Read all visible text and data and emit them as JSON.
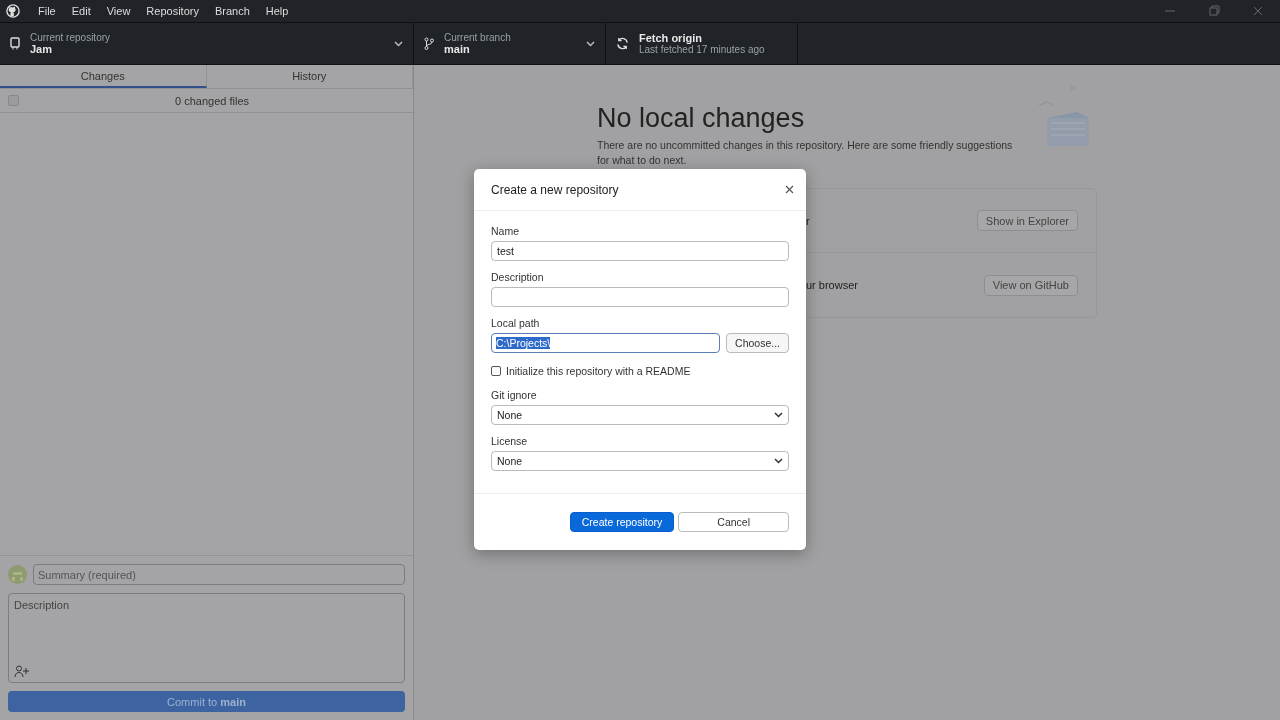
{
  "menu": [
    "File",
    "Edit",
    "View",
    "Repository",
    "Branch",
    "Help"
  ],
  "toolbar": {
    "repository": {
      "label": "Current repository",
      "value": "Jam"
    },
    "branch": {
      "label": "Current branch",
      "value": "main"
    },
    "fetch": {
      "label": "Fetch origin",
      "detail": "Last fetched 17 minutes ago"
    }
  },
  "sidebar": {
    "tabs": [
      {
        "label": "Changes",
        "selected": true
      },
      {
        "label": "History",
        "selected": false
      }
    ],
    "select_all": {
      "checked": false
    },
    "changed_files": "0 changed files",
    "summary": {
      "placeholder": "Summary (required)"
    },
    "description": {
      "placeholder": "Description"
    },
    "commit_button": {
      "label": "Commit to **main**",
      "disabled": true
    }
  },
  "main": {
    "title": "No local changes",
    "text": "There are no uncommitted changes in this repository. Here are some friendly suggestions for what to do next.",
    "suggestions": [
      {
        "text": "r",
        "button": "Show in Explorer"
      },
      {
        "text": "ur browser",
        "button": "View on GitHub"
      }
    ]
  },
  "dialog": {
    "title": "Create a new repository",
    "fields": [
      {
        "kind": "text",
        "label": "Name",
        "value": "test"
      },
      {
        "kind": "text",
        "label": "Description"
      },
      {
        "kind": "path",
        "label": "Local path",
        "value": "C:\\Projects\\",
        "highlighted": true,
        "button": "Choose..."
      },
      {
        "kind": "checkbox",
        "label": "Initialize this repository with a README",
        "checked": false
      },
      {
        "kind": "select",
        "label": "Git ignore",
        "value": "None"
      },
      {
        "kind": "select",
        "label": "License",
        "value": "None"
      }
    ],
    "buttons": [
      {
        "kind": "primary",
        "label": "Create repository"
      },
      {
        "kind": "secondary",
        "label": "Cancel"
      }
    ]
  }
}
